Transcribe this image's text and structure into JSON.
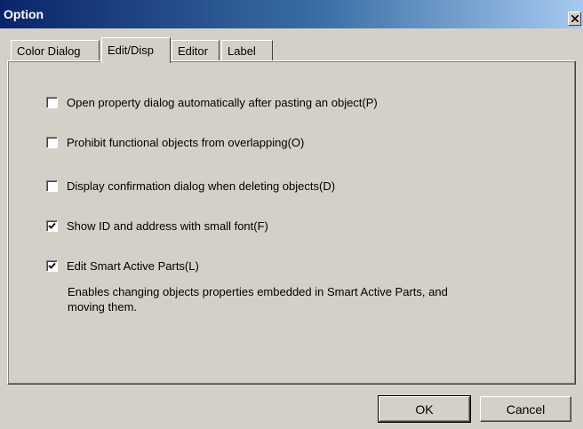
{
  "window": {
    "title": "Option"
  },
  "tabs": [
    {
      "label": "Color Dialog",
      "active": false
    },
    {
      "label": "Edit/Disp",
      "active": true
    },
    {
      "label": "Editor",
      "active": false
    },
    {
      "label": "Label",
      "active": false
    }
  ],
  "options": [
    {
      "label": "Open property dialog automatically after pasting an object(P)",
      "checked": false
    },
    {
      "label": "Prohibit functional objects from overlapping(O)",
      "checked": false
    },
    {
      "label": "Display confirmation dialog when deleting objects(D)",
      "checked": false
    },
    {
      "label": "Show ID and address with small font(F)",
      "checked": true
    },
    {
      "label": "Edit Smart Active Parts(L)",
      "checked": true
    }
  ],
  "description": "Enables changing objects properties embedded in Smart Active Parts, and moving them.",
  "buttons": {
    "ok": "OK",
    "cancel": "Cancel"
  },
  "colors": {
    "face": "#d4d0c8",
    "title_start": "#0a246a",
    "title_end": "#a6caf0"
  }
}
